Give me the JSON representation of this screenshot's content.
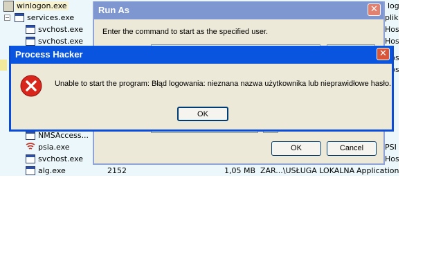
{
  "tree": {
    "rows": [
      {
        "name": "winlogon.exe",
        "extra": "log",
        "indent": 1,
        "icon": "winlogon-icon",
        "selected": true
      },
      {
        "name": "services.exe",
        "extra": "plik",
        "indent": 1,
        "icon": "window-icon",
        "expander": "−"
      },
      {
        "name": "svchost.exe",
        "extra": "Host",
        "indent": 2,
        "icon": "window-icon"
      },
      {
        "name": "svchost.exe",
        "extra": "Host",
        "indent": 2,
        "icon": "window-icon"
      },
      {
        "name": "NMSAccess...",
        "extra": "",
        "indent": 2,
        "icon": "window-icon"
      },
      {
        "name": "psia.exe",
        "extra": "PSI",
        "indent": 2,
        "icon": "signal-icon"
      },
      {
        "name": "svchost.exe",
        "extra": "Host",
        "indent": 2,
        "icon": "window-icon"
      },
      {
        "name": "alg.exe",
        "extra": "Application L",
        "indent": 2,
        "icon": "window-icon",
        "pid": "2152",
        "memory": "1,05 MB",
        "user": "ZAR...\\USŁUGA LOKALNA"
      }
    ],
    "partial_right": [
      "Host",
      "Host",
      "Host",
      "Host",
      "Host",
      "Host"
    ]
  },
  "runas": {
    "title": "Run As",
    "prompt": "Enter the command to start as the specified user.",
    "ok_label": "OK",
    "cancel_label": "Cancel"
  },
  "error_dialog": {
    "title": "Process Hacker",
    "message": "Unable to start the program: Błąd logowania: nieznana nazwa użytkownika lub nieprawidłowe hasło.",
    "ok_label": "OK",
    "icon": "error-x-icon",
    "close_glyph": "✕"
  },
  "colors": {
    "active_title": "#0a55e0",
    "inactive_title": "#7e97d0",
    "dialog_face": "#ece9d8",
    "tree_bg": "#ecf7fb",
    "error_red": "#d9261c"
  }
}
